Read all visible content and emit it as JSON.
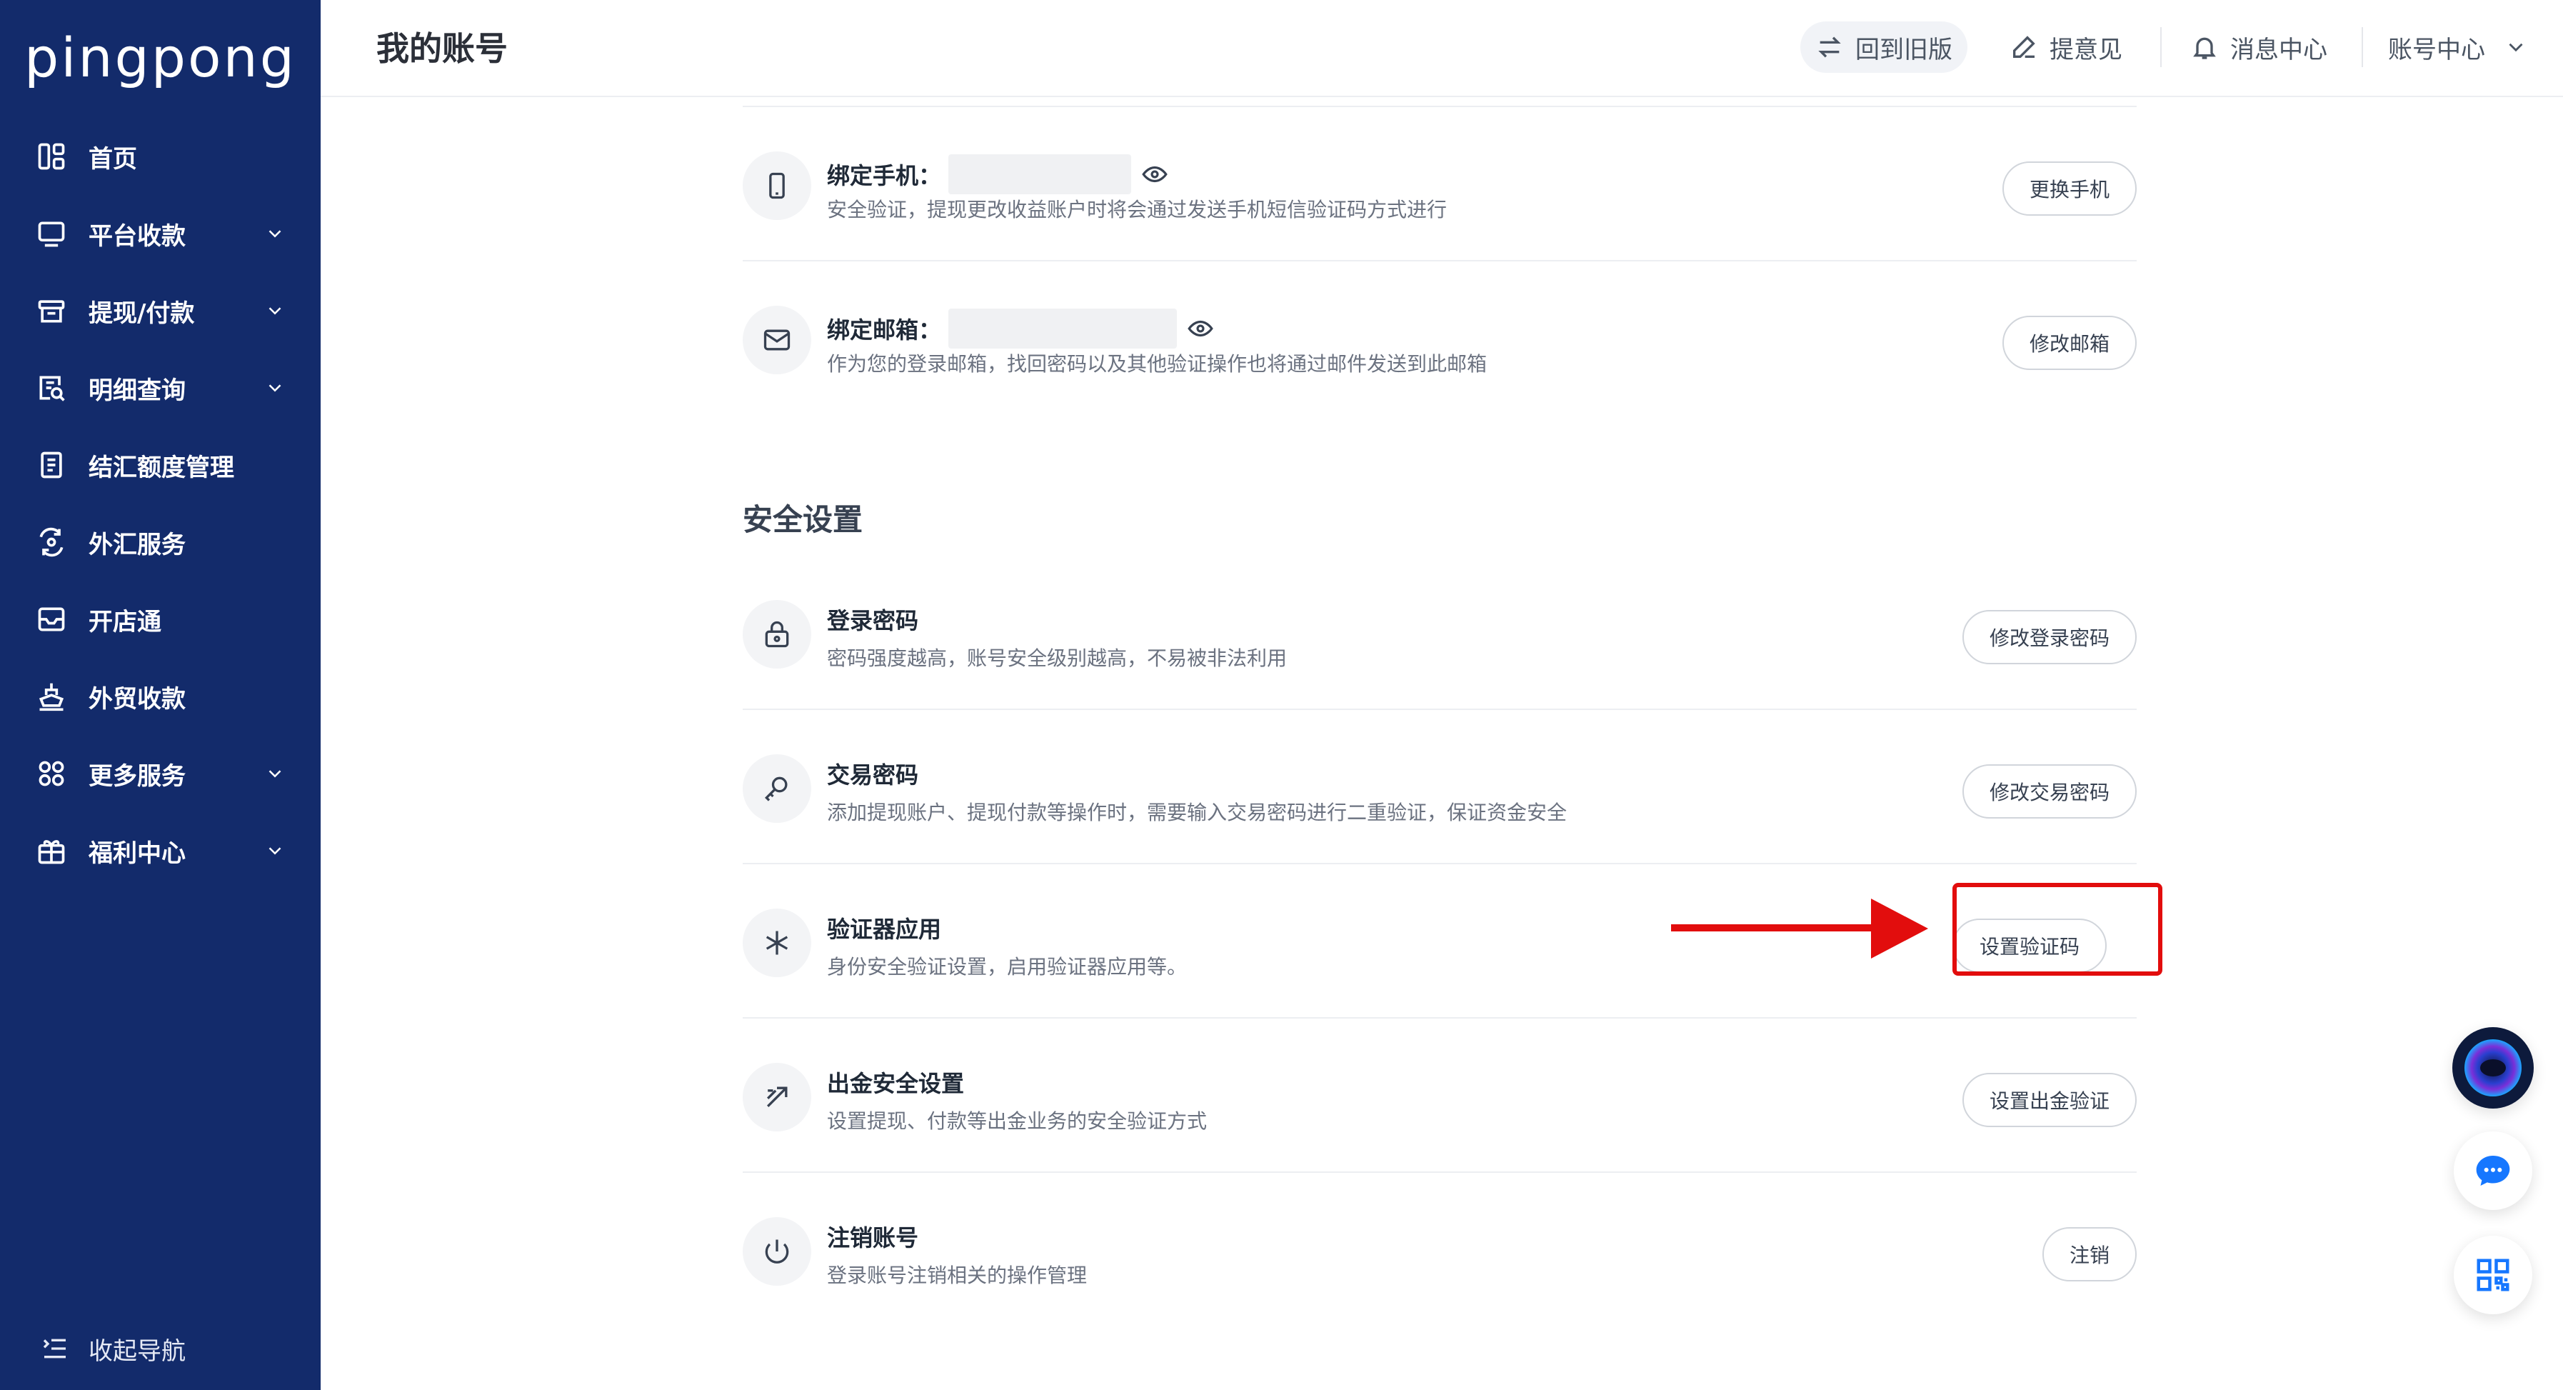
{
  "sidebar": {
    "logo": "pingpong",
    "items": [
      {
        "label": "首页",
        "icon": "home-grid-icon",
        "has_chevron": false
      },
      {
        "label": "平台收款",
        "icon": "monitor-icon",
        "has_chevron": true
      },
      {
        "label": "提现/付款",
        "icon": "wallet-icon",
        "has_chevron": true
      },
      {
        "label": "明细查询",
        "icon": "detail-search-icon",
        "has_chevron": true
      },
      {
        "label": "结汇额度管理",
        "icon": "ledger-icon",
        "has_chevron": false
      },
      {
        "label": "外汇服务",
        "icon": "exchange-icon",
        "has_chevron": false
      },
      {
        "label": "开店通",
        "icon": "shop-icon",
        "has_chevron": false
      },
      {
        "label": "外贸收款",
        "icon": "ship-icon",
        "has_chevron": false
      },
      {
        "label": "更多服务",
        "icon": "more-grid-icon",
        "has_chevron": true
      },
      {
        "label": "福利中心",
        "icon": "gift-icon",
        "has_chevron": true
      }
    ],
    "collapse_label": "收起导航"
  },
  "header": {
    "title": "我的账号",
    "old_version": "回到旧版",
    "feedback": "提意见",
    "messages": "消息中心",
    "account": "账号中心"
  },
  "bindings": [
    {
      "title": "绑定手机：",
      "desc": "安全验证，提现更改收益账户时将会通过发送手机短信验证码方式进行",
      "button": "更换手机",
      "icon": "phone-icon"
    },
    {
      "title": "绑定邮箱：",
      "desc": "作为您的登录邮箱，找回密码以及其他验证操作也将通过邮件发送到此邮箱",
      "button": "修改邮箱",
      "icon": "mail-icon"
    }
  ],
  "security": {
    "title": "安全设置",
    "items": [
      {
        "title": "登录密码",
        "desc": "密码强度越高，账号安全级别越高，不易被非法利用",
        "button": "修改登录密码",
        "icon": "lock-icon"
      },
      {
        "title": "交易密码",
        "desc": "添加提现账户、提现付款等操作时，需要输入交易密码进行二重验证，保证资金安全",
        "button": "修改交易密码",
        "icon": "key-icon"
      },
      {
        "title": "验证器应用",
        "desc": "身份安全验证设置，启用验证器应用等。",
        "button": "设置验证码",
        "icon": "asterisk-icon"
      },
      {
        "title": "出金安全设置",
        "desc": "设置提现、付款等出金业务的安全验证方式",
        "button": "设置出金验证",
        "icon": "withdraw-arrows-icon"
      },
      {
        "title": "注销账号",
        "desc": "登录账号注销相关的操作管理",
        "button": "注销",
        "icon": "power-icon"
      }
    ]
  },
  "colors": {
    "sidebar_bg": "#132b6b",
    "highlight": "#e20d0d",
    "float_accent": "#1677ff"
  }
}
